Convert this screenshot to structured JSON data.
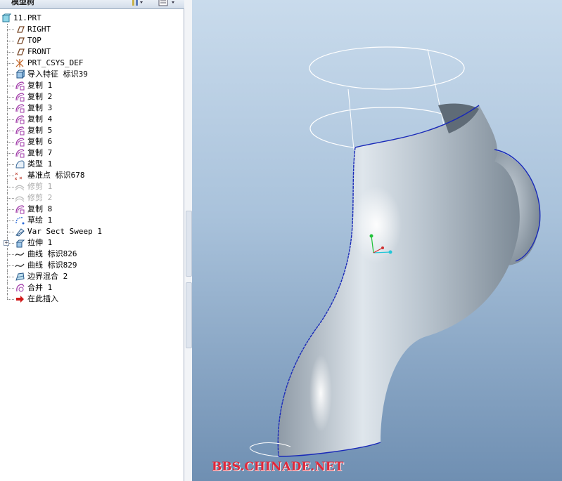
{
  "panel": {
    "title": "模型树"
  },
  "tree": {
    "root": "11.PRT",
    "items": [
      {
        "label": "RIGHT",
        "icon": "datum-plane-icon"
      },
      {
        "label": "TOP",
        "icon": "datum-plane-icon"
      },
      {
        "label": "FRONT",
        "icon": "datum-plane-icon"
      },
      {
        "label": "PRT_CSYS_DEF",
        "icon": "coordinate-system-icon"
      },
      {
        "label": "导入特征 标识39",
        "icon": "import-feature-icon"
      },
      {
        "label": "复制 1",
        "icon": "copy-surface-icon"
      },
      {
        "label": "复制 2",
        "icon": "copy-surface-icon"
      },
      {
        "label": "复制 3",
        "icon": "copy-surface-icon"
      },
      {
        "label": "复制 4",
        "icon": "copy-surface-icon"
      },
      {
        "label": "复制 5",
        "icon": "copy-surface-icon"
      },
      {
        "label": "复制 6",
        "icon": "copy-surface-icon"
      },
      {
        "label": "复制 7",
        "icon": "copy-surface-icon"
      },
      {
        "label": "类型 1",
        "icon": "type-feature-icon"
      },
      {
        "label": "基准点 标识678",
        "icon": "datum-point-icon"
      },
      {
        "label": "修剪 1",
        "icon": "trim-icon",
        "suppressed": true
      },
      {
        "label": "修剪 2",
        "icon": "trim-icon",
        "suppressed": true
      },
      {
        "label": "复制 8",
        "icon": "copy-surface-icon"
      },
      {
        "label": "草绘 1",
        "icon": "sketch-icon"
      },
      {
        "label": "Var Sect Sweep 1",
        "icon": "sweep-icon"
      },
      {
        "label": "拉伸 1",
        "icon": "extrude-icon",
        "expandable": true
      },
      {
        "label": "曲线 标识826",
        "icon": "curve-icon"
      },
      {
        "label": "曲线 标识829",
        "icon": "curve-icon"
      },
      {
        "label": "边界混合 2",
        "icon": "boundary-blend-icon"
      },
      {
        "label": "合并 1",
        "icon": "merge-icon"
      },
      {
        "label": "在此插入",
        "icon": "insert-here-arrow-icon"
      }
    ]
  },
  "viewport": {
    "watermark": "BBS.CHINADE.NET"
  },
  "colors": {
    "viewport_top": "#c9dbec",
    "viewport_bottom": "#6f8fb2",
    "surface": "#b7c2cc",
    "edge": "#1a2ab8",
    "watermark": "#e0283a"
  }
}
